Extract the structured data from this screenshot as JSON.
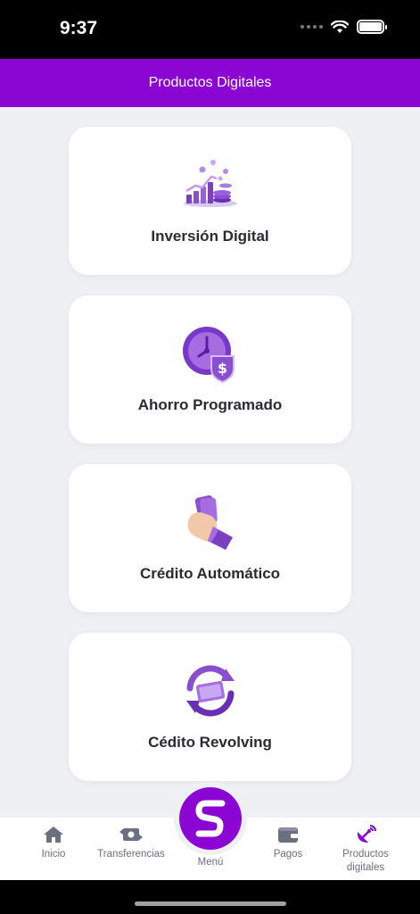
{
  "status": {
    "time": "9:37"
  },
  "header": {
    "title": "Productos Digitales"
  },
  "cards": [
    {
      "title": "Inversión Digital",
      "icon": "investment-chart-icon"
    },
    {
      "title": "Ahorro Programado",
      "icon": "savings-clock-icon"
    },
    {
      "title": "Crédito Automático",
      "icon": "cash-hand-icon"
    },
    {
      "title": "Cédito Revolving",
      "icon": "revolving-credit-icon"
    }
  ],
  "nav": {
    "items": [
      {
        "label": "Inicio",
        "icon": "home-icon"
      },
      {
        "label": "Transferencias",
        "icon": "transfer-icon"
      },
      {
        "label": "Menú",
        "icon": "menu-logo-icon"
      },
      {
        "label": "Pagos",
        "icon": "wallet-icon"
      },
      {
        "label": "Productos digitales",
        "icon": "satellite-icon"
      }
    ]
  },
  "colors": {
    "brand": "#8b06d2",
    "background": "#eef0f4",
    "text": "#2a2a33",
    "nav_text": "#6b6f80"
  }
}
